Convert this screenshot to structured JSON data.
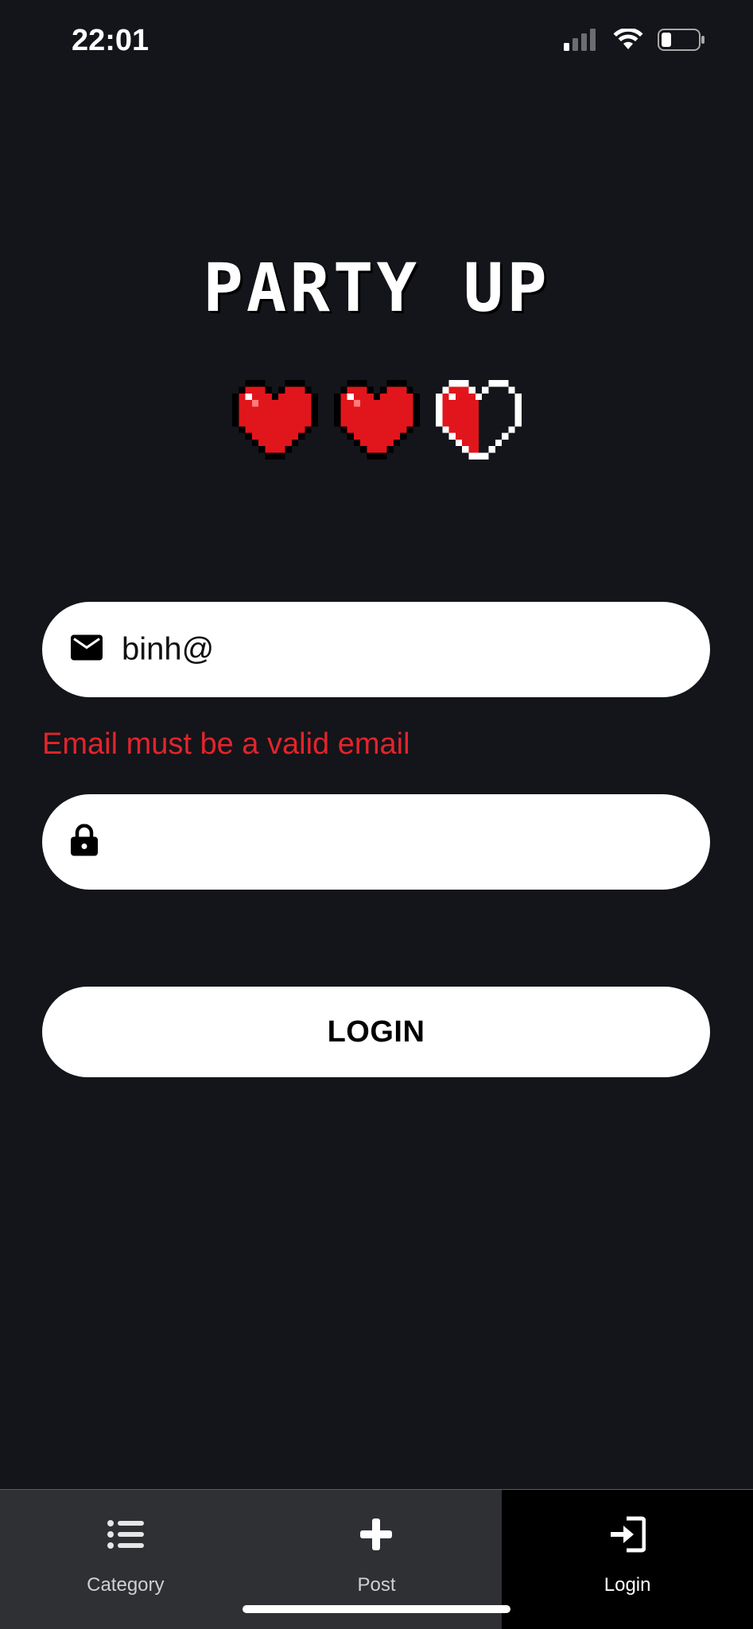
{
  "status_bar": {
    "time": "22:01"
  },
  "brand": {
    "title": "PARTY UP",
    "hearts": [
      1,
      1,
      0.5
    ]
  },
  "form": {
    "email": {
      "value": "binh@",
      "icon": "envelope-icon"
    },
    "email_error": "Email must be a valid email",
    "password": {
      "value": "",
      "icon": "lock-icon"
    },
    "login_label": "LOGIN"
  },
  "tab_bar": {
    "tabs": [
      {
        "label": "Category",
        "icon": "list-icon",
        "active": false
      },
      {
        "label": "Post",
        "icon": "plus-icon",
        "active": false
      },
      {
        "label": "Login",
        "icon": "sign-in-icon",
        "active": true
      }
    ]
  },
  "colors": {
    "background": "#13151a",
    "error": "#e3242b",
    "heart": "#e0161c",
    "tab_bar": "#2e3034",
    "active_tab": "#000000"
  }
}
